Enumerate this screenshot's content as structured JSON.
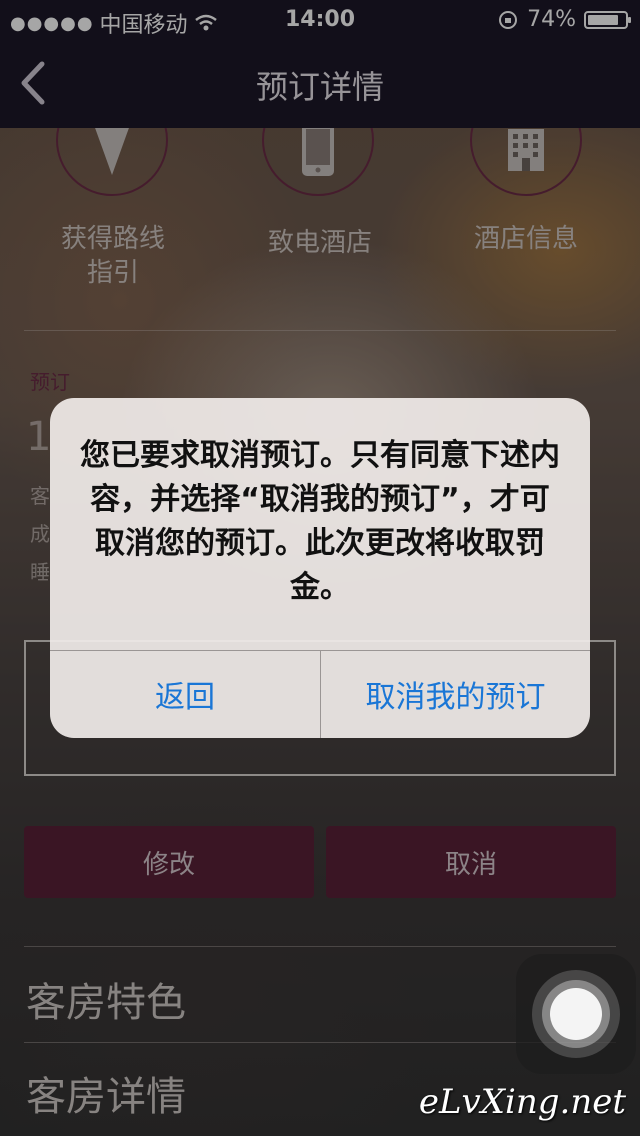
{
  "status_bar": {
    "carrier": "中国移动",
    "time": "14:00",
    "battery": "74%",
    "battery_level": 0.74
  },
  "nav": {
    "title": "预订详情",
    "back_icon": "chevron-left-icon"
  },
  "quick_actions": [
    {
      "icon": "direction-arrow-icon",
      "label_line1": "获得路线",
      "label_line2": "指引"
    },
    {
      "icon": "phone-icon",
      "label_line1": "致电酒店"
    },
    {
      "icon": "building-icon",
      "label_line1": "酒店信息"
    }
  ],
  "booking": {
    "section_label": "预订",
    "partial_number": "1",
    "partial_lines": [
      "客",
      "成",
      "睡"
    ]
  },
  "actions": {
    "modify_label": "修改",
    "cancel_label": "取消"
  },
  "sections": [
    "客房特色",
    "客房详情"
  ],
  "alert": {
    "message": "您已要求取消预订。只有同意下述内容，并选择“取消我的预订”，才可取消您的预订。此次更改将收取罚金。",
    "back_label": "返回",
    "confirm_label": "取消我的预订"
  },
  "watermark": "eLvXing.net",
  "colors": {
    "nav_bg": "#1c1728",
    "brand_plum": "#5a2138",
    "alert_button": "#1a76d6"
  }
}
